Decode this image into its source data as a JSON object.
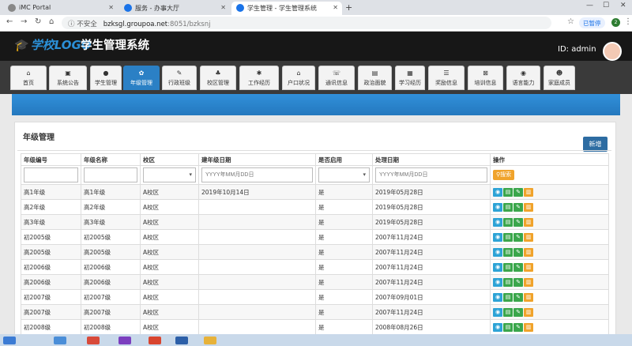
{
  "browser": {
    "tabs": [
      {
        "title": "iMC Portal"
      },
      {
        "title": "服务 - 办事大厅"
      },
      {
        "title": "学生管理 - 学生管理系统"
      }
    ],
    "security": "不安全",
    "url_host": "bzksgl.groupoa.net",
    "url_path": ":8051/bzksnj",
    "paused": "已暂停",
    "profile_initial": "2"
  },
  "app": {
    "logo": "学校LOGO",
    "title": "学生管理系统",
    "user": "ID: admin",
    "nav": [
      {
        "label": "首页",
        "icon": "home-icon",
        "glyph": "⌂"
      },
      {
        "label": "系统公告",
        "icon": "picture-icon",
        "glyph": "▣"
      },
      {
        "label": "学生管理",
        "icon": "user-icon",
        "glyph": "●"
      },
      {
        "label": "年级管理",
        "icon": "gear-icon",
        "glyph": "✿"
      },
      {
        "label": "行政班级",
        "icon": "edit-icon",
        "glyph": "✎"
      },
      {
        "label": "校区管理",
        "icon": "sitemap-icon",
        "glyph": "♣"
      },
      {
        "label": "工作经历",
        "icon": "asterisk-icon",
        "glyph": "✱"
      },
      {
        "label": "户口状况",
        "icon": "home-icon",
        "glyph": "⌂"
      },
      {
        "label": "通讯信息",
        "icon": "phone-icon",
        "glyph": "☏"
      },
      {
        "label": "政治面貌",
        "icon": "file-icon",
        "glyph": "▤"
      },
      {
        "label": "学习经历",
        "icon": "briefcase-icon",
        "glyph": "▦"
      },
      {
        "label": "奖励信息",
        "icon": "list-icon",
        "glyph": "☰"
      },
      {
        "label": "培训信息",
        "icon": "x-square-icon",
        "glyph": "⊠"
      },
      {
        "label": "语言能力",
        "icon": "comment-icon",
        "glyph": "◉"
      },
      {
        "label": "家庭成员",
        "icon": "users-icon",
        "glyph": "☻"
      }
    ],
    "active_nav": 3
  },
  "page": {
    "title": "年级管理",
    "add_label": "新增",
    "search_label": "搜索",
    "date_placeholder": "YYYY年MM月DD日",
    "columns": [
      "年级编号",
      "年级名称",
      "校区",
      "建年级日期",
      "是否启用",
      "处理日期",
      "操作"
    ],
    "rows": [
      {
        "id": "高1年级",
        "name": "高1年级",
        "campus": "A校区",
        "build": "2019年10月14日",
        "enabled": "是",
        "date": "2019年05月28日"
      },
      {
        "id": "高2年级",
        "name": "高2年级",
        "campus": "A校区",
        "build": "",
        "enabled": "是",
        "date": "2019年05月28日"
      },
      {
        "id": "高3年级",
        "name": "高3年级",
        "campus": "A校区",
        "build": "",
        "enabled": "是",
        "date": "2019年05月28日"
      },
      {
        "id": "初2005级",
        "name": "初2005级",
        "campus": "A校区",
        "build": "",
        "enabled": "是",
        "date": "2007年11月24日"
      },
      {
        "id": "高2005级",
        "name": "高2005级",
        "campus": "A校区",
        "build": "",
        "enabled": "是",
        "date": "2007年11月24日"
      },
      {
        "id": "初2006级",
        "name": "初2006级",
        "campus": "A校区",
        "build": "",
        "enabled": "是",
        "date": "2007年11月24日"
      },
      {
        "id": "高2006级",
        "name": "高2006级",
        "campus": "A校区",
        "build": "",
        "enabled": "是",
        "date": "2007年11月24日"
      },
      {
        "id": "初2007级",
        "name": "初2007级",
        "campus": "A校区",
        "build": "",
        "enabled": "是",
        "date": "2007年09月01日"
      },
      {
        "id": "高2007级",
        "name": "高2007级",
        "campus": "A校区",
        "build": "",
        "enabled": "是",
        "date": "2007年11月24日"
      },
      {
        "id": "初2008级",
        "name": "初2008级",
        "campus": "A校区",
        "build": "",
        "enabled": "是",
        "date": "2008年08月26日"
      }
    ]
  }
}
